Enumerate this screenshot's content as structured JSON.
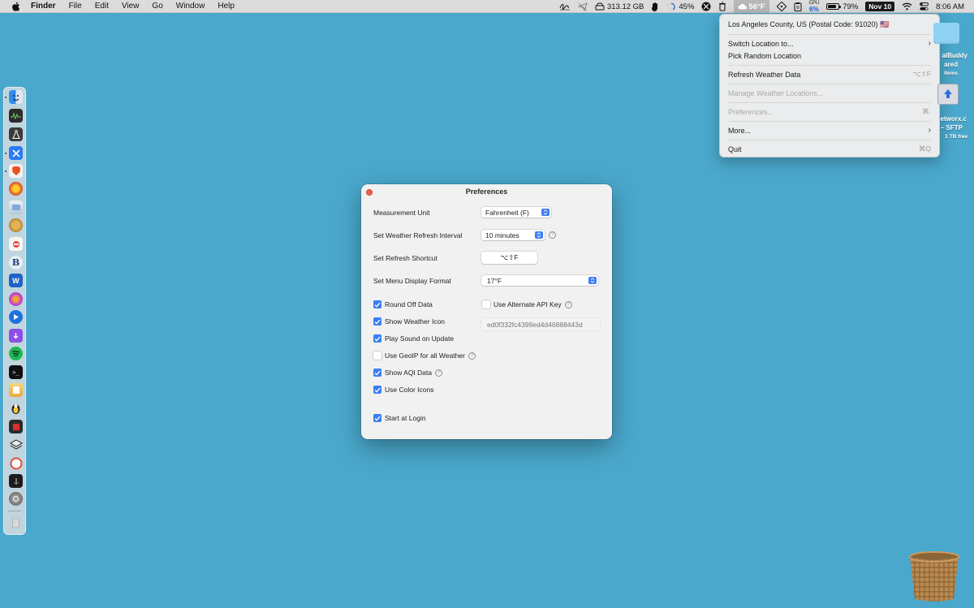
{
  "menubar": {
    "app_name": "Finder",
    "menus": [
      "File",
      "Edit",
      "View",
      "Go",
      "Window",
      "Help"
    ],
    "status": {
      "disk": "313.12 GB",
      "usage": "45%",
      "weather": "56°F",
      "cpu_label": "CPU",
      "cpu_value": "6%",
      "battery": "79%",
      "battery_level": 0.79,
      "date": "Nov 10",
      "time": "8:06 AM"
    }
  },
  "weather_menu": {
    "location": "Los Angeles County, US (Postal Code: 91020) 🇺🇸",
    "items": [
      {
        "label": "Switch Location to...",
        "shortcut": "›"
      },
      {
        "label": "Pick Random Location",
        "shortcut": ""
      },
      {
        "label": "Refresh Weather Data",
        "shortcut": "⌥⇧F"
      },
      {
        "label": "Manage Weather Locations...",
        "shortcut": ""
      },
      {
        "label": "Preferences...",
        "shortcut": "⌘,"
      },
      {
        "label": "More...",
        "shortcut": "›"
      },
      {
        "label": "Quit",
        "shortcut": "⌘Q"
      }
    ]
  },
  "desktop": {
    "folder_label_1": "alBuddy",
    "folder_label_2": "ared",
    "folder_label_3": "items",
    "drive_label_1": "etworx.c",
    "drive_label_2": "– SFTP",
    "drive_label_3": "1 TB free"
  },
  "preferences": {
    "title": "Preferences",
    "measurement_label": "Measurement Unit",
    "measurement_value": "Fahrenheit (F)",
    "refresh_interval_label": "Set Weather Refresh Interval",
    "refresh_interval_value": "10 minutes",
    "shortcut_label": "Set Refresh Shortcut",
    "shortcut_value": "⌥⇧F",
    "display_format_label": "Set Menu Display Format",
    "display_format_value": "17°F",
    "checkboxes": {
      "round_off": "Round Off Data",
      "show_icon": "Show Weather Icon",
      "play_sound": "Play Sound on Update",
      "geoip": "Use GeoIP for all Weather",
      "aqi": "Show AQI Data",
      "color_icons": "Use Color Icons",
      "start_login": "Start at Login",
      "alt_api": "Use Alternate API Key"
    },
    "api_key_placeholder": "ed0f332fc4399ed4d46888443d"
  }
}
